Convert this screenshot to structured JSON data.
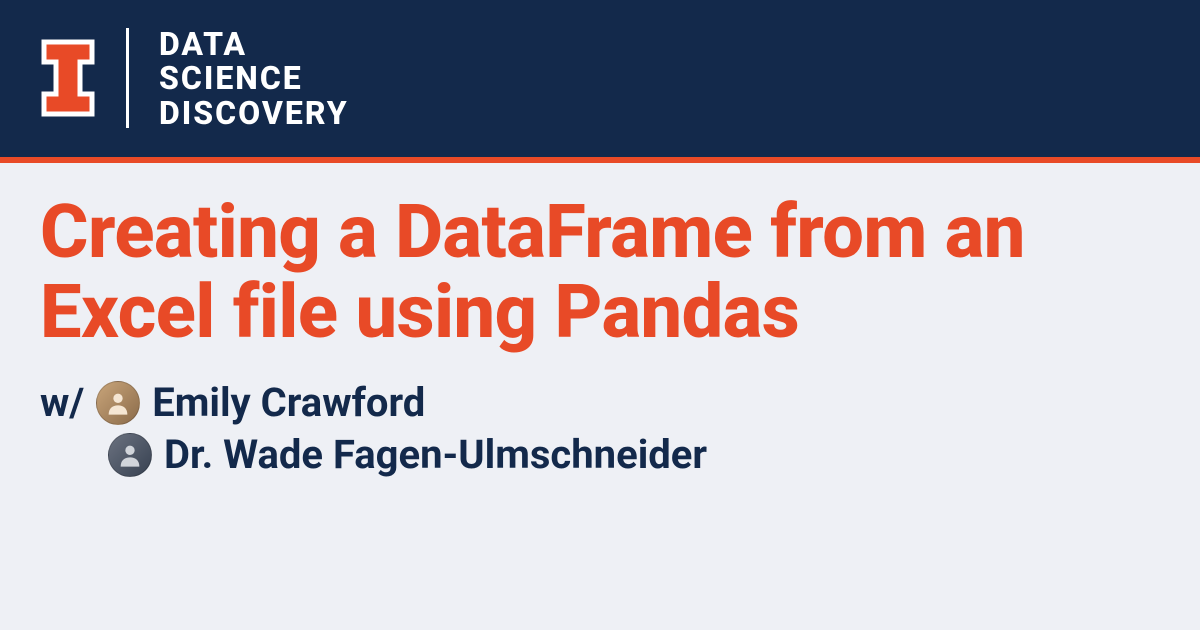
{
  "brand": {
    "wordmark_line1": "DATA",
    "wordmark_line2": "SCIENCE",
    "wordmark_line3": "DISCOVERY"
  },
  "title": "Creating a DataFrame from an Excel file using Pandas",
  "authors": {
    "prefix": "w/",
    "list": [
      {
        "name": "Emily Crawford"
      },
      {
        "name": "Dr. Wade Fagen-Ulmschneider"
      }
    ]
  },
  "colors": {
    "navy": "#13294b",
    "orange": "#e84a27",
    "background": "#eef0f5"
  }
}
